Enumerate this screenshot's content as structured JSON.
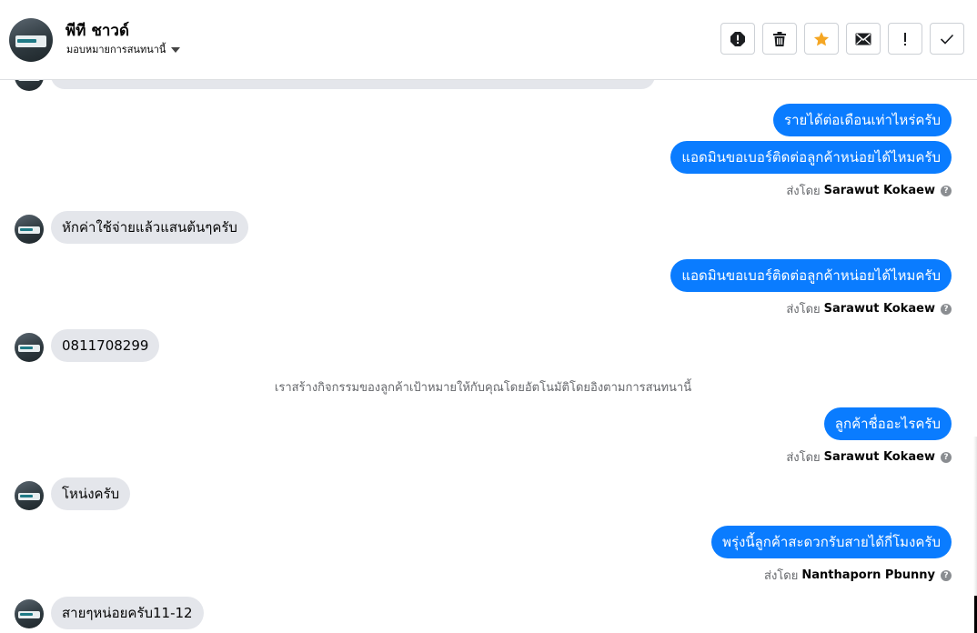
{
  "header": {
    "contact_name": "พีที ชาวด์",
    "assign_label": "มอบหมายการสนทนานี้",
    "actions": [
      {
        "name": "spam-icon",
        "label": "!"
      },
      {
        "name": "trash-icon",
        "label": ""
      },
      {
        "name": "star-icon",
        "label": ""
      },
      {
        "name": "mail-icon",
        "label": ""
      },
      {
        "name": "follow-up-icon",
        "label": "!"
      },
      {
        "name": "done-icon",
        "label": ""
      }
    ],
    "accent_star": "#f5a623"
  },
  "messages": [
    {
      "dir": "out",
      "text": "รายได้ต่อเดือนเท่าไหร่ครับ"
    },
    {
      "dir": "out",
      "text": "แอดมินขอเบอร์ติดต่อลูกค้าหน่อยได้ไหมครับ"
    },
    {
      "dir": "sent_by",
      "prefix": "ส่งโดย",
      "name": "Sarawut Kokaew"
    },
    {
      "dir": "in",
      "text": "หักค่าใช้จ่ายแล้วแสนต้นๆครับ"
    },
    {
      "dir": "out",
      "text": "แอดมินขอเบอร์ติดต่อลูกค้าหน่อยได้ไหมครับ"
    },
    {
      "dir": "sent_by",
      "prefix": "ส่งโดย",
      "name": "Sarawut Kokaew"
    },
    {
      "dir": "in",
      "text": "0811708299"
    },
    {
      "dir": "system",
      "text": "เราสร้างกิจกรรมของลูกค้าเป้าหมายให้กับคุณโดยอัตโนมัติโดยอิงตามการสนทนานี้"
    },
    {
      "dir": "out",
      "text": "ลูกค้าชื่ออะไรครับ"
    },
    {
      "dir": "sent_by",
      "prefix": "ส่งโดย",
      "name": "Sarawut Kokaew"
    },
    {
      "dir": "in",
      "text": "โหน่งครับ"
    },
    {
      "dir": "out",
      "text": "พรุ่งนี้ลูกค้าสะดวกรับสายได้กี่โมงครับ"
    },
    {
      "dir": "sent_by",
      "prefix": "ส่งโดย",
      "name": "Nanthaporn Pbunny"
    },
    {
      "dir": "in",
      "text": "สายๆหน่อยครับ11-12"
    }
  ],
  "colors": {
    "outgoing_bubble": "#0a7cff",
    "incoming_bubble": "#e4e6eb",
    "meta_text": "#65676b"
  }
}
